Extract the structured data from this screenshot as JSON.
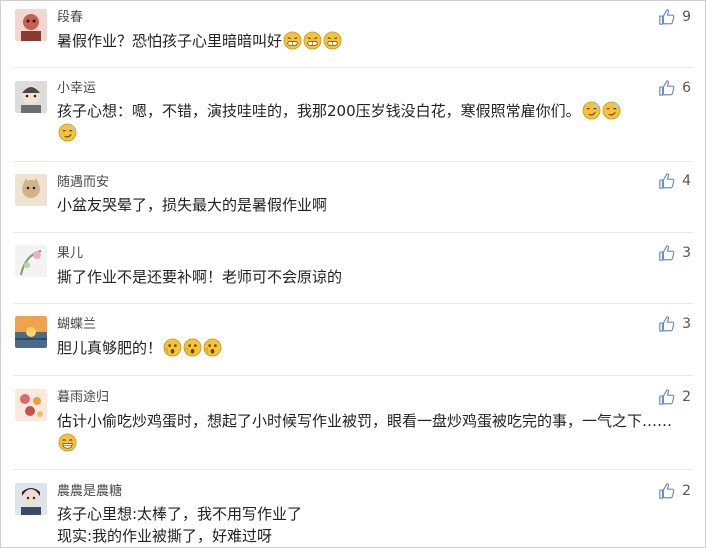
{
  "comments": [
    {
      "name": "段春",
      "text": "暑假作业？恐怕孩子心里暗暗叫好",
      "likes": "9",
      "emojis": [
        "grin-teeth-emoji",
        "grin-teeth-emoji",
        "grin-teeth-emoji"
      ],
      "avatar_color": "#c9604f"
    },
    {
      "name": "小幸运",
      "text": "孩子心想：嗯，不错，演技哇哇的，我那200压岁钱没白花，寒假照常雇你们。",
      "likes": "6",
      "emojis": [
        "smirk-emoji",
        "smirk-emoji",
        "smirk-emoji"
      ],
      "avatar_color": "#6d6d6d"
    },
    {
      "name": "随遇而安",
      "text": "小盆友哭晕了，损失最大的是暑假作业啊",
      "likes": "4",
      "emojis": [],
      "avatar_color": "#d2b48c"
    },
    {
      "name": "果儿",
      "text": "撕了作业不是还要补啊！老师可不会原谅的",
      "likes": "3",
      "emojis": [],
      "avatar_color": "#a9a9a9"
    },
    {
      "name": "蝴蝶兰",
      "text": "胆儿真够肥的！",
      "likes": "3",
      "emojis": [
        "shocked-emoji",
        "shocked-emoji",
        "shocked-emoji"
      ],
      "avatar_color": "#d38a3a"
    },
    {
      "name": "暮雨途归",
      "text": "估计小偷吃炒鸡蛋时，想起了小时候写作业被罚，眼看一盘炒鸡蛋被吃完的事，一气之下……",
      "likes": "2",
      "emojis": [
        "big-grin-emoji"
      ],
      "avatar_color": "#d86b6b"
    },
    {
      "name": "農農是農糖",
      "text_lines": [
        "孩子心里想:太棒了，我不用写作业了",
        "现实:我的作业被撕了，好难过呀"
      ],
      "likes": "2",
      "emojis": [],
      "avatar_color": "#3b4a6b"
    }
  ],
  "colors": {
    "like_icon": "#6b8cc4",
    "separator": "#e9e9e9",
    "emoji_face": "#f5c33b"
  }
}
